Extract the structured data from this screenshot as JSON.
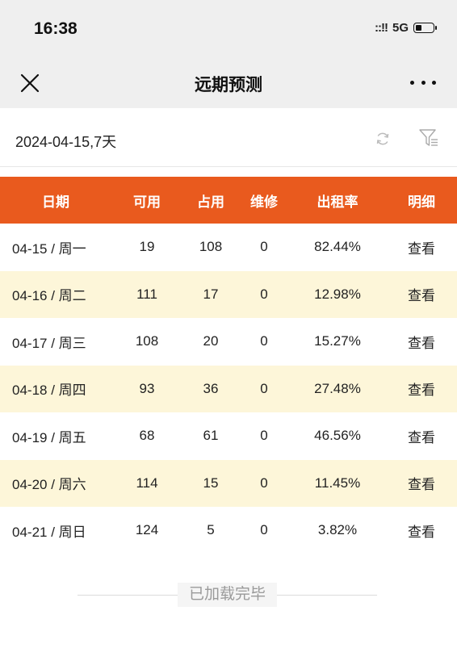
{
  "status": {
    "time": "16:38",
    "signal": "::!!",
    "network": "5G",
    "battery_level": 0.35
  },
  "nav": {
    "title": "远期预测",
    "close_icon": "close-icon",
    "more_icon": "more-icon"
  },
  "filter": {
    "text": "2024-04-15,7天",
    "refresh_icon": "refresh-icon",
    "filter_icon": "filter-icon"
  },
  "table": {
    "headers": [
      "日期",
      "可用",
      "占用",
      "维修",
      "出租率",
      "明细"
    ],
    "rows": [
      {
        "date": "04-15 / 周一",
        "available": "19",
        "occupied": "108",
        "repair": "0",
        "rate": "82.44%",
        "detail": "查看"
      },
      {
        "date": "04-16 / 周二",
        "available": "111",
        "occupied": "17",
        "repair": "0",
        "rate": "12.98%",
        "detail": "查看"
      },
      {
        "date": "04-17 / 周三",
        "available": "108",
        "occupied": "20",
        "repair": "0",
        "rate": "15.27%",
        "detail": "查看"
      },
      {
        "date": "04-18 / 周四",
        "available": "93",
        "occupied": "36",
        "repair": "0",
        "rate": "27.48%",
        "detail": "查看"
      },
      {
        "date": "04-19 / 周五",
        "available": "68",
        "occupied": "61",
        "repair": "0",
        "rate": "46.56%",
        "detail": "查看"
      },
      {
        "date": "04-20 / 周六",
        "available": "114",
        "occupied": "15",
        "repair": "0",
        "rate": "11.45%",
        "detail": "查看"
      },
      {
        "date": "04-21 / 周日",
        "available": "124",
        "occupied": "5",
        "repair": "0",
        "rate": "3.82%",
        "detail": "查看"
      }
    ]
  },
  "footer": {
    "text": "已加载完毕"
  },
  "colors": {
    "header_bg": "#e95a1e",
    "alt_row_bg": "#fdf6d9",
    "bar_bg": "#efefef"
  }
}
